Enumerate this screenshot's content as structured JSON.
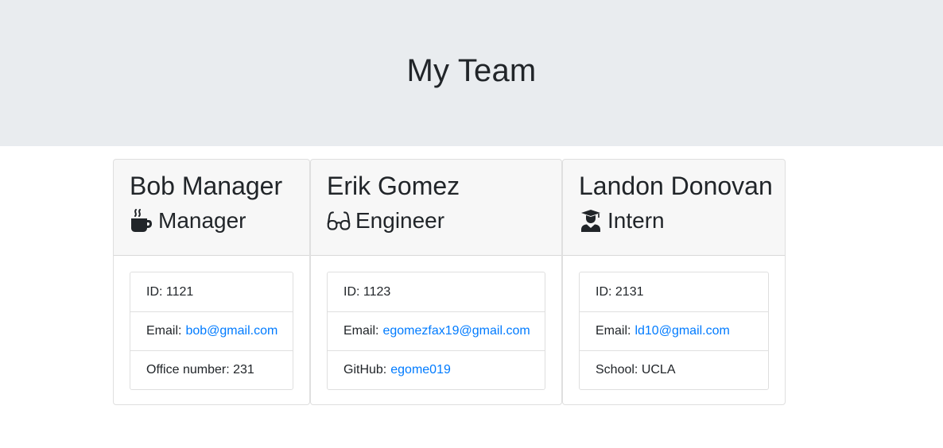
{
  "header": {
    "title": "My Team"
  },
  "team": [
    {
      "name": "Bob Manager",
      "role": "Manager",
      "role_icon": "mug-hot-icon",
      "id_line": "ID: 1121",
      "email_label": "Email:",
      "email": "bob@gmail.com",
      "extra_label": "Office number: 231",
      "extra_link": ""
    },
    {
      "name": "Erik Gomez",
      "role": "Engineer",
      "role_icon": "glasses-icon",
      "id_line": "ID: 1123",
      "email_label": "Email:",
      "email": "egomezfax19@gmail.com",
      "extra_label": "GitHub:",
      "extra_link": "egome019"
    },
    {
      "name": "Landon Donovan",
      "role": "Intern",
      "role_icon": "user-graduate-icon",
      "id_line": "ID: 2131",
      "email_label": "Email:",
      "email": "ld10@gmail.com",
      "extra_label": "School: UCLA",
      "extra_link": ""
    }
  ],
  "colors": {
    "link": "#007bff",
    "jumbotron_bg": "#e9ecef",
    "text": "#212529"
  }
}
